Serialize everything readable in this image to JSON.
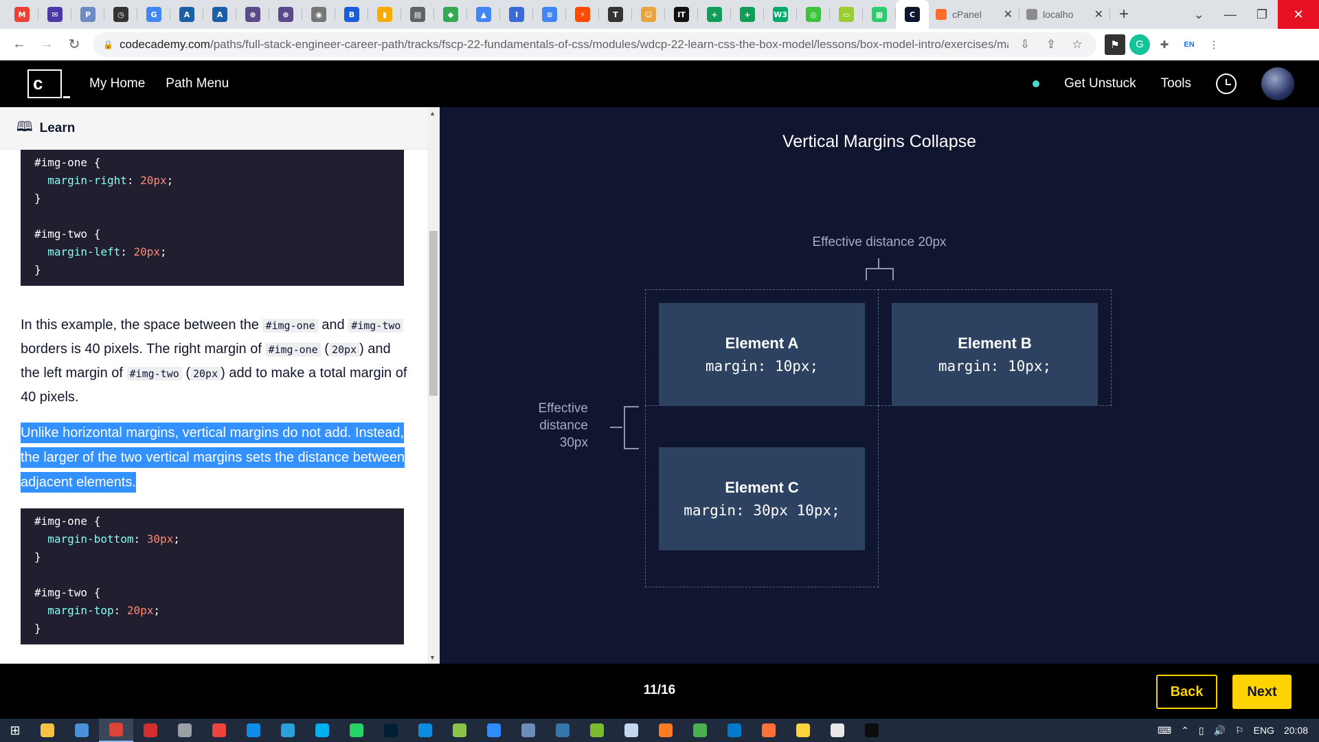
{
  "browser": {
    "pinned_tabs": [
      {
        "icon": "gmail-icon",
        "color": "#ea4335",
        "glyph": "M"
      },
      {
        "icon": "mail-icon",
        "color": "#4a3aa8",
        "glyph": "✉"
      },
      {
        "icon": "pma-icon",
        "color": "#6d8bc4",
        "glyph": "P"
      },
      {
        "icon": "timer-icon",
        "color": "#333333",
        "glyph": "◷"
      },
      {
        "icon": "translate-icon",
        "color": "#4285f4",
        "glyph": "G"
      },
      {
        "icon": "adobe-icon",
        "color": "#1a5fa8",
        "glyph": "A"
      },
      {
        "icon": "adobe-icon",
        "color": "#1a5fa8",
        "glyph": "A"
      },
      {
        "icon": "portal-icon",
        "color": "#5b4a8a",
        "glyph": "⊕"
      },
      {
        "icon": "portal-icon",
        "color": "#5b4a8a",
        "glyph": "⊕"
      },
      {
        "icon": "globe-icon",
        "color": "#777777",
        "glyph": "◉"
      },
      {
        "icon": "bitwarden-icon",
        "color": "#175ddc",
        "glyph": "B"
      },
      {
        "icon": "analytics-icon",
        "color": "#f9ab00",
        "glyph": "▮"
      },
      {
        "icon": "printer-icon",
        "color": "#5f6368",
        "glyph": "▤"
      },
      {
        "icon": "drive-icon",
        "color": "#34a853",
        "glyph": "◆"
      },
      {
        "icon": "ads-icon",
        "color": "#4285f4",
        "glyph": "▲"
      },
      {
        "icon": "ipfi-icon",
        "color": "#3a6ad8",
        "glyph": "I"
      },
      {
        "icon": "docs-icon",
        "color": "#4285f4",
        "glyph": "≡"
      },
      {
        "icon": "zapier-icon",
        "color": "#ff4a00",
        "glyph": "⚡"
      },
      {
        "icon": "trello-icon",
        "color": "#333333",
        "glyph": "T"
      },
      {
        "icon": "chrome-ext-icon",
        "color": "#e8a33d",
        "glyph": "☺"
      },
      {
        "icon": "it-icon",
        "color": "#111111",
        "glyph": "IT"
      },
      {
        "icon": "sheets-plus-icon",
        "color": "#0f9d58",
        "glyph": "+"
      },
      {
        "icon": "sheets-plus-icon",
        "color": "#0f9d58",
        "glyph": "+"
      },
      {
        "icon": "w3schools-icon",
        "color": "#04aa6d",
        "glyph": "W3"
      },
      {
        "icon": "green-app-icon",
        "color": "#3cc33c",
        "glyph": "◎"
      },
      {
        "icon": "slides-icon",
        "color": "#9acd32",
        "glyph": "▭"
      },
      {
        "icon": "sheets-icon",
        "color": "#2ecc71",
        "glyph": "▦"
      },
      {
        "icon": "codecademy-icon",
        "color": "#10162f",
        "glyph": "C"
      }
    ],
    "tabs": [
      {
        "label": "cPanel",
        "icon_color": "#ff6c2c",
        "close": "✕"
      },
      {
        "label": "localho",
        "icon_color": "#8c8c8c",
        "close": "✕"
      }
    ],
    "new_tab": "+",
    "url_host": "codecademy.com",
    "url_path": "/paths/full-stack-engineer-career-path/tracks/fscp-22-fundamentals-of-css/modules/wdcp-22-learn-css-the-box-model/lessons/box-model-intro/exercises/margi..."
  },
  "header": {
    "logo": "c",
    "nav": [
      "My Home",
      "Path Menu"
    ],
    "get_unstuck": "Get Unstuck",
    "tools": "Tools"
  },
  "learn": {
    "title": "Learn",
    "code1": {
      "sel1": "#img-one {",
      "prop1": "margin-right",
      "val1": "20px",
      "close": "}",
      "sel2": "#img-two {",
      "prop2": "margin-left",
      "val2": "20px"
    },
    "para1": {
      "t1": "In this example, the space between the ",
      "c1": "#img-one",
      "t2": " and ",
      "c2": "#img-two",
      "t3": " borders is 40 pixels. The right margin of ",
      "c3": "#img-one",
      "t4": " (",
      "c4": "20px",
      "t5": ") and the left margin of ",
      "c5": "#img-two",
      "t6": " (",
      "c6": "20px",
      "t7": ") add to make a total margin of 40 pixels."
    },
    "highlight": "Unlike horizontal margins, vertical margins do not add. Instead, the larger of the two vertical margins sets the distance between adjacent elements.",
    "code2": {
      "sel1": "#img-one {",
      "prop1": "margin-bottom",
      "val1": "30px",
      "close": "}",
      "sel2": "#img-two {",
      "prop2": "margin-top",
      "val2": "20px"
    }
  },
  "diagram": {
    "title": "Vertical Margins Collapse",
    "effective_top": "Effective distance 20px",
    "effective_left": [
      "Effective",
      "distance",
      "30px"
    ],
    "elements": [
      {
        "name": "Element A",
        "margin": "margin: 10px;"
      },
      {
        "name": "Element B",
        "margin": "margin: 10px;"
      },
      {
        "name": "Element C",
        "margin": "margin: 30px 10px;"
      }
    ]
  },
  "footer": {
    "progress": "11/16",
    "back": "Back",
    "next": "Next"
  },
  "taskbar": {
    "apps": [
      {
        "icon": "file-explorer-icon",
        "color": "#f6c244"
      },
      {
        "icon": "remote-desktop-icon",
        "color": "#4a90d9"
      },
      {
        "icon": "chrome-icon",
        "color": "#db4437",
        "active": true
      },
      {
        "icon": "acrobat-icon",
        "color": "#d32f2f"
      },
      {
        "icon": "settings-icon",
        "color": "#9aa0a6"
      },
      {
        "icon": "anydesk-icon",
        "color": "#ef443b"
      },
      {
        "icon": "teamviewer-icon",
        "color": "#0e8ee9"
      },
      {
        "icon": "telegram-icon",
        "color": "#2aa1da"
      },
      {
        "icon": "skype-icon",
        "color": "#00aff0"
      },
      {
        "icon": "whatsapp-icon",
        "color": "#25d366"
      },
      {
        "icon": "photoshop-icon",
        "color": "#001e36"
      },
      {
        "icon": "edge-icon",
        "color": "#0c8ee0"
      },
      {
        "icon": "notepadpp-icon",
        "color": "#8bc34a"
      },
      {
        "icon": "zoom-icon",
        "color": "#2d8cff"
      },
      {
        "icon": "network-icon",
        "color": "#6b8fb8"
      },
      {
        "icon": "python-icon",
        "color": "#3776ab"
      },
      {
        "icon": "package-icon",
        "color": "#7cbb2f"
      },
      {
        "icon": "notepad-icon",
        "color": "#c4d7ef"
      },
      {
        "icon": "xampp-icon",
        "color": "#fb7a24"
      },
      {
        "icon": "sheets-app-icon",
        "color": "#4caf50"
      },
      {
        "icon": "vscode-icon",
        "color": "#007acc"
      },
      {
        "icon": "firefox-icon",
        "color": "#ff7139"
      },
      {
        "icon": "python-idle-icon",
        "color": "#ffd43b"
      },
      {
        "icon": "script-icon",
        "color": "#e8e8e8"
      },
      {
        "icon": "terminal-icon",
        "color": "#0c0c0c"
      }
    ],
    "lang": "ENG",
    "time": "20:08"
  }
}
